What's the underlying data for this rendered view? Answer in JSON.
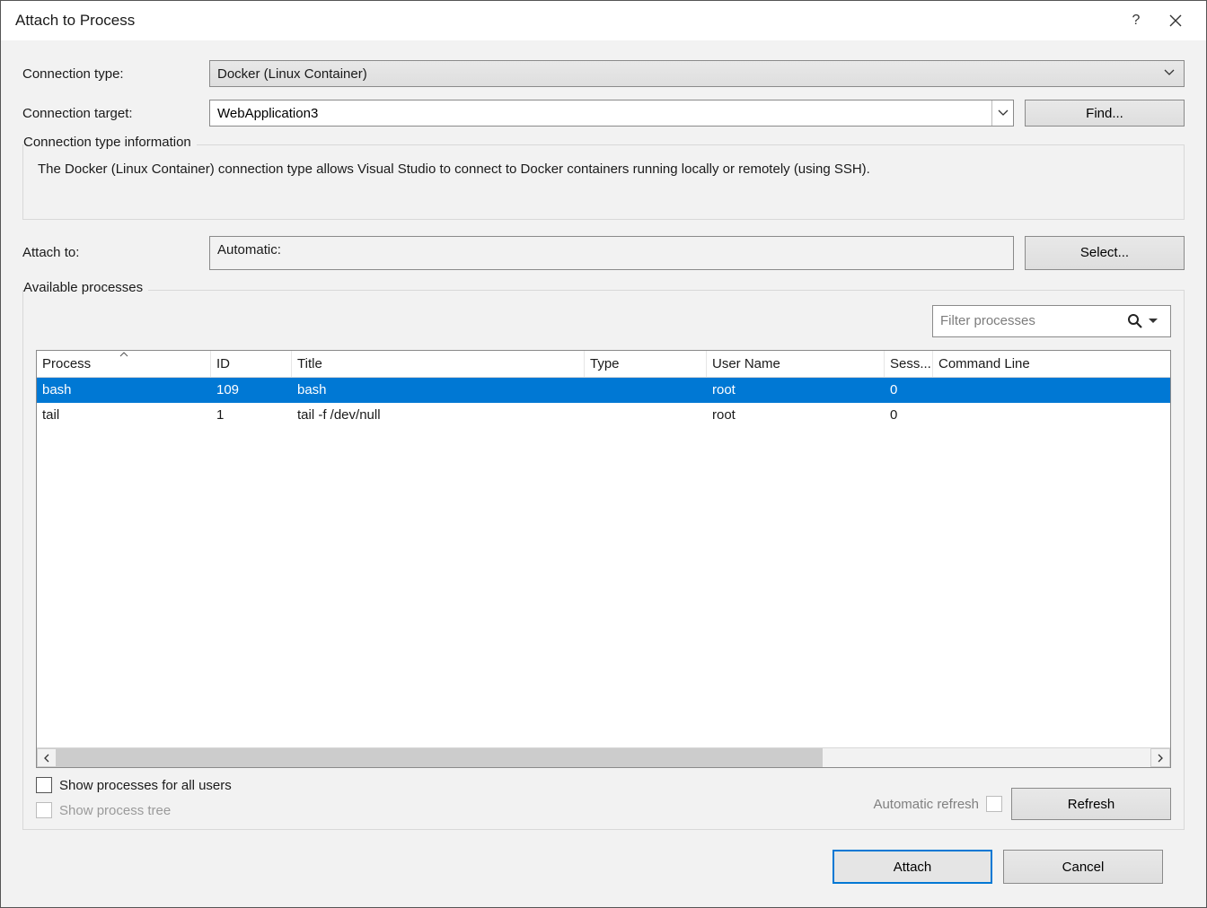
{
  "title": "Attach to Process",
  "labels": {
    "connection_type": "Connection type:",
    "connection_target": "Connection target:",
    "attach_to": "Attach to:",
    "available_processes": "Available processes",
    "conn_info_heading": "Connection type information",
    "show_all_users": "Show processes for all users",
    "show_tree": "Show process tree",
    "auto_refresh": "Automatic refresh"
  },
  "buttons": {
    "find": "Find...",
    "select": "Select...",
    "refresh": "Refresh",
    "attach": "Attach",
    "cancel": "Cancel"
  },
  "fields": {
    "connection_type": "Docker (Linux Container)",
    "connection_target": "WebApplication3",
    "attach_to": "Automatic:",
    "filter_placeholder": "Filter processes"
  },
  "info_text": "The Docker (Linux Container) connection type allows Visual Studio to connect to Docker containers running locally or remotely (using SSH).",
  "columns": {
    "process": "Process",
    "id": "ID",
    "title": "Title",
    "type": "Type",
    "user": "User Name",
    "sess": "Sess...",
    "cmd": "Command Line"
  },
  "processes": [
    {
      "process": "bash",
      "id": "109",
      "title": "bash",
      "type": "",
      "user": "root",
      "sess": "0",
      "cmd": "",
      "selected": true
    },
    {
      "process": "tail",
      "id": "1",
      "title": "tail -f /dev/null",
      "type": "",
      "user": "root",
      "sess": "0",
      "cmd": "",
      "selected": false
    }
  ]
}
